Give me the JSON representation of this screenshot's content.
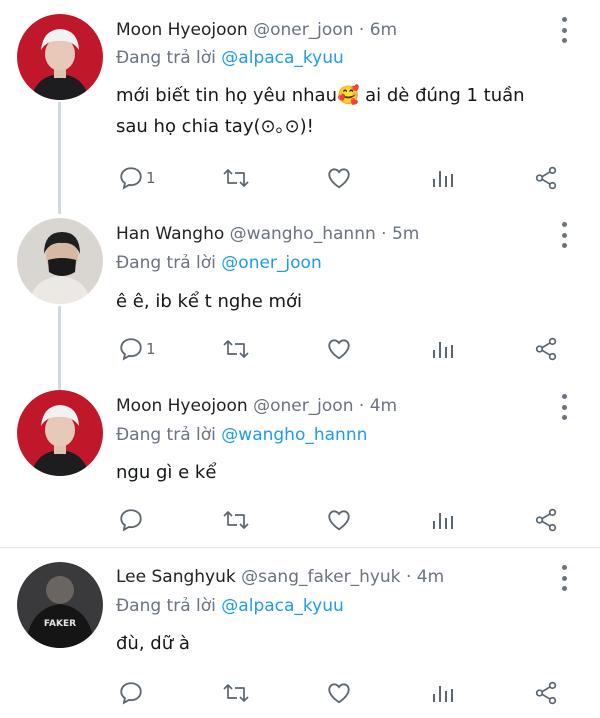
{
  "replies": [
    {
      "display_name": "Moon Hyeojoon",
      "handle": "@oner_joon",
      "separator": "·",
      "time": "6m",
      "reply_prefix": "Đang trả lời",
      "reply_to": "@alpaca_kyuu",
      "text_line1": "mới biết tin họ yêu nhau🥰 ai dè đúng 1 tuần",
      "text_line2": "sau họ chia tay(⊙｡⊙)!",
      "reply_count": "1",
      "avatar_icon": "avatar-white-hair"
    },
    {
      "display_name": "Han Wangho",
      "handle": "@wangho_hannn",
      "separator": "·",
      "time": "5m",
      "reply_prefix": "Đang trả lời",
      "reply_to": "@oner_joon",
      "text_line1": "ê ê, ib kể t nghe mới",
      "reply_count": "1",
      "avatar_icon": "avatar-masked"
    },
    {
      "display_name": "Moon Hyeojoon",
      "handle": "@oner_joon",
      "separator": "·",
      "time": "4m",
      "reply_prefix": "Đang trả lời",
      "reply_to": "@wangho_hannn",
      "text_line1": "ngu gì e kể",
      "reply_count": "",
      "avatar_icon": "avatar-white-hair"
    },
    {
      "display_name": "Lee Sanghyuk",
      "handle": "@sang_faker_hyuk",
      "separator": "·",
      "time": "4m",
      "reply_prefix": "Đang trả lời",
      "reply_to": "@alpaca_kyuu",
      "text_line1": "đù, dữ à",
      "reply_count": "",
      "avatar_icon": "avatar-faker-jacket",
      "avatar_text": "FAKER"
    }
  ],
  "colors": {
    "mention": "#1d9bf0",
    "secondary_text": "#6b7280",
    "thread_line": "#cfd9de",
    "divider": "#e1e8ed"
  },
  "action_icons": [
    "reply-icon",
    "retweet-icon",
    "like-icon",
    "analytics-icon",
    "share-icon"
  ]
}
